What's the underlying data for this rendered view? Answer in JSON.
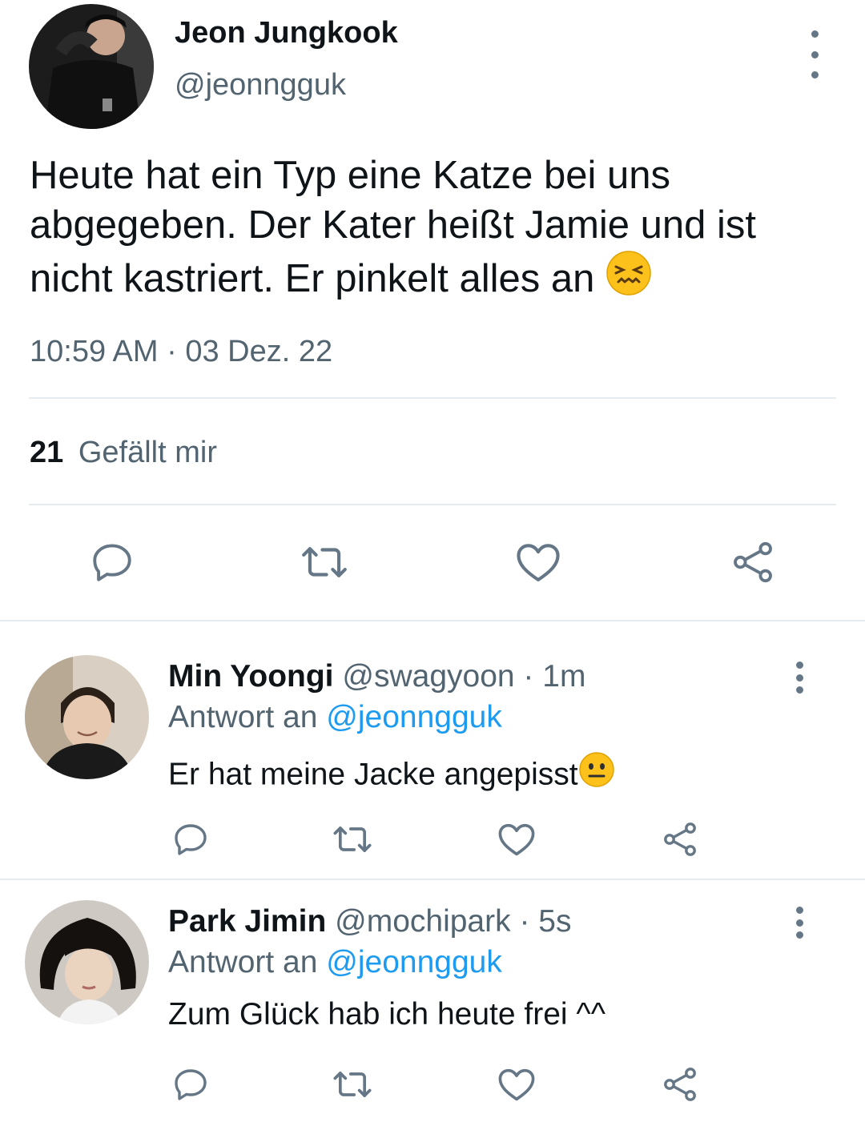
{
  "tweet": {
    "author_name": "Jeon Jungkook",
    "author_handle": "@jeonngguk",
    "text_line1": "Heute hat ein Typ eine Katze bei uns",
    "text_line2": "abgegeben. Der Kater heißt Jamie und ist",
    "text_line3": "nicht kastriert. Er pinkelt alles an",
    "timestamp": "10:59 AM · 03 Dez. 22",
    "likes_count": "21",
    "likes_label": "Gefällt mir"
  },
  "replies": [
    {
      "author_name": "Min Yoongi",
      "author_handle": "@swagyoon",
      "time": " · 1m",
      "reply_to_label": "Antwort an",
      "reply_to_handle": "@jeonngguk",
      "text": "Er hat meine Jacke angepisst"
    },
    {
      "author_name": "Park Jimin",
      "author_handle": "@mochipark",
      "time": " · 5s",
      "reply_to_label": "Antwort an",
      "reply_to_handle": "@jeonngguk",
      "text": "Zum Glück hab ich heute frei ^^"
    }
  ],
  "icons": {
    "reply": "reply-icon",
    "retweet": "retweet-icon",
    "like": "heart-icon",
    "share": "share-icon",
    "more": "more-vertical-icon"
  },
  "colors": {
    "link": "#1d9bf0",
    "muted": "#536471",
    "icon": "#657786",
    "divider": "#e6ecf0"
  }
}
